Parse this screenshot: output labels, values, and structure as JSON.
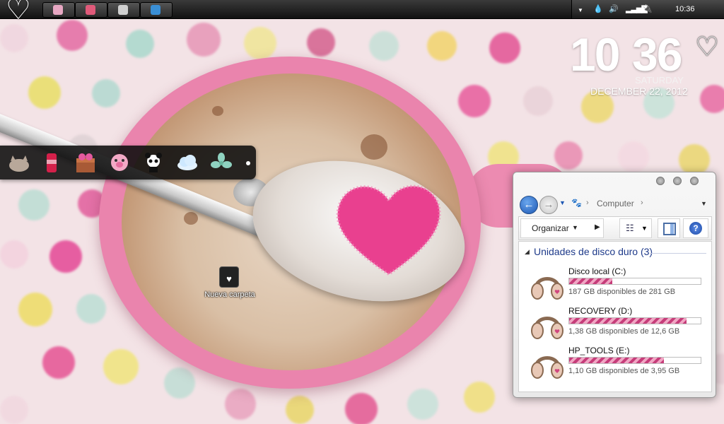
{
  "taskbar": {
    "start_icon": "heart-icon",
    "apps": [
      {
        "name": "taskbar-app-1",
        "icon": "app-icon",
        "color": "#e7a7c2"
      },
      {
        "name": "taskbar-app-2",
        "icon": "app-icon",
        "color": "#e05a7a"
      },
      {
        "name": "taskbar-app-3",
        "icon": "app-icon",
        "color": "#d0d0d0"
      },
      {
        "name": "taskbar-app-4",
        "icon": "app-icon",
        "color": "#3a8fd6"
      }
    ],
    "tray_icons": [
      "chevron-up-icon",
      "drop-icon",
      "volume-icon",
      "signal-icon",
      "power-icon"
    ],
    "clock": "10:36"
  },
  "widget_clock": {
    "hour": "10",
    "minute": "36",
    "day": "SATURDAY",
    "date": "DECEMBER 22, 2012"
  },
  "dock": {
    "items": [
      "cat-icon",
      "soda-can-icon",
      "gift-box-icon",
      "pig-icon",
      "panda-icon",
      "cloud-icon",
      "flower-icon"
    ]
  },
  "desktop": {
    "folder_label": "Nueva carpeta"
  },
  "explorer": {
    "address": "Computer",
    "toolbar": {
      "organize": "Organizar",
      "help": "?"
    },
    "group_title": "Unidades de disco duro (3)",
    "drives": [
      {
        "name": "Disco local (C:)",
        "free_text": "187 GB disponibles de 281 GB",
        "used_fraction": 0.33
      },
      {
        "name": "RECOVERY (D:)",
        "free_text": "1,38 GB disponibles de 12,6 GB",
        "used_fraction": 0.89
      },
      {
        "name": "HP_TOOLS (E:)",
        "free_text": "1,10 GB disponibles de 3,95 GB",
        "used_fraction": 0.72
      }
    ]
  },
  "colors": {
    "accent": "#1d57b3",
    "usage_bar": "#c63d7a",
    "cup": "#ea84ad"
  }
}
